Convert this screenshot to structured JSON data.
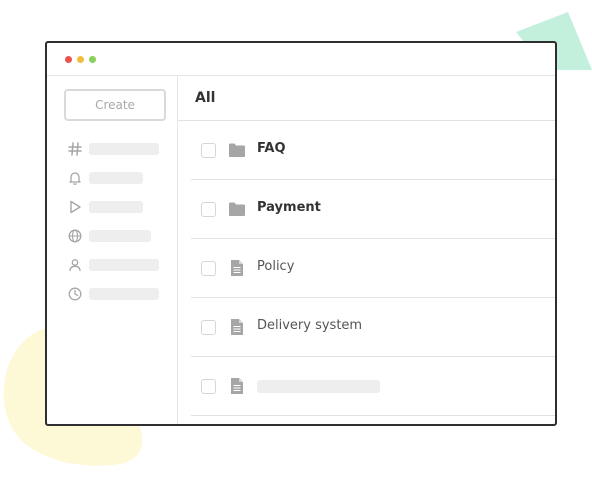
{
  "colors": {
    "dot_red": "#e8534d",
    "dot_yellow": "#f2bd3a",
    "dot_green": "#8bd05a",
    "deco_mint": "#c3f0dc",
    "deco_yellow": "#fdf8d6",
    "icon_gray": "#a6a6a6"
  },
  "sidebar": {
    "create_label": "Create",
    "items": [
      {
        "icon": "hash-icon"
      },
      {
        "icon": "bell-icon"
      },
      {
        "icon": "play-icon"
      },
      {
        "icon": "globe-icon"
      },
      {
        "icon": "user-icon"
      },
      {
        "icon": "clock-icon"
      }
    ]
  },
  "main": {
    "title": "All",
    "rows": [
      {
        "type": "folder",
        "label": "FAQ",
        "bold": true
      },
      {
        "type": "folder",
        "label": "Payment",
        "bold": true
      },
      {
        "type": "document",
        "label": "Policy",
        "bold": false
      },
      {
        "type": "document",
        "label": "Delivery system",
        "bold": false
      },
      {
        "type": "document",
        "label": "",
        "bold": false
      }
    ]
  }
}
